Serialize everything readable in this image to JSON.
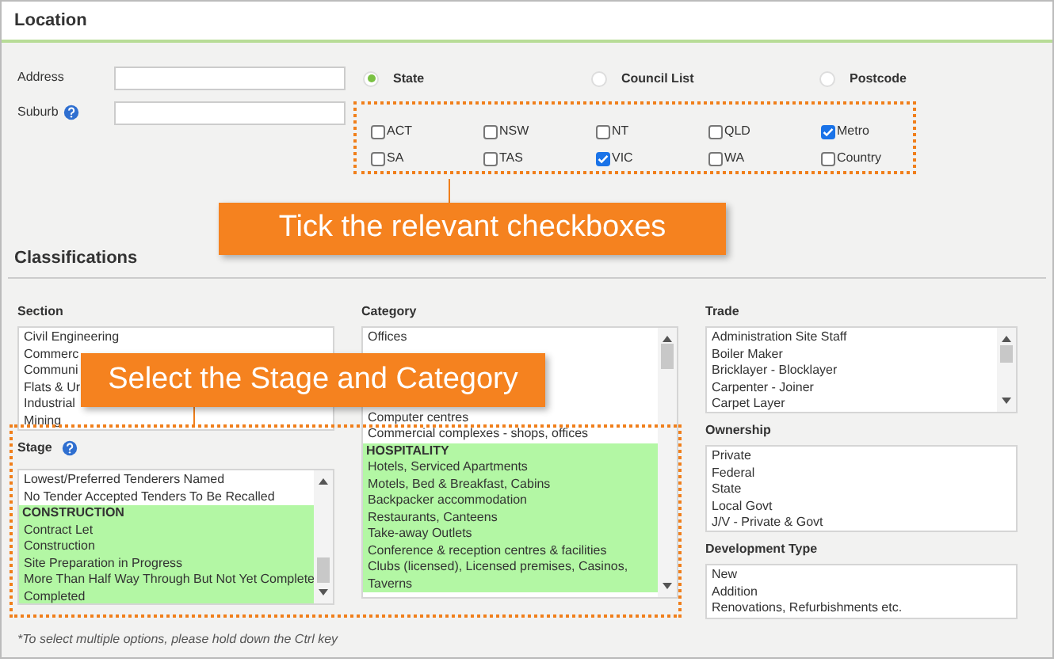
{
  "location": {
    "title": "Location",
    "address": {
      "label": "Address"
    },
    "suburb": {
      "label": "Suburb"
    },
    "modes": [
      {
        "label": "State",
        "selected": true
      },
      {
        "label": "Council List",
        "selected": false
      },
      {
        "label": "Postcode",
        "selected": false
      }
    ],
    "states": [
      {
        "label": "ACT",
        "checked": false
      },
      {
        "label": "NSW",
        "checked": false
      },
      {
        "label": "NT",
        "checked": false
      },
      {
        "label": "QLD",
        "checked": false
      },
      {
        "label": "Metro",
        "checked": true
      },
      {
        "label": "SA",
        "checked": false
      },
      {
        "label": "TAS",
        "checked": false
      },
      {
        "label": "VIC",
        "checked": true
      },
      {
        "label": "WA",
        "checked": false
      },
      {
        "label": "Country",
        "checked": false
      }
    ]
  },
  "classifications": {
    "title": "Classifications",
    "section": {
      "label": "Section",
      "items": [
        "Civil Engineering",
        "Commerc",
        "Communi",
        "Flats & Ur",
        "Industrial",
        "Mining"
      ]
    },
    "stage": {
      "label": "Stage",
      "items": [
        {
          "text": "Lowest/Preferred Tenderers Named",
          "kind": "option",
          "selected": false
        },
        {
          "text": "No Tender Accepted Tenders To Be Recalled",
          "kind": "option",
          "selected": false
        },
        {
          "text": "CONSTRUCTION",
          "kind": "group",
          "selected": true
        },
        {
          "text": "Contract Let",
          "kind": "option",
          "selected": true
        },
        {
          "text": "Construction",
          "kind": "option",
          "selected": true
        },
        {
          "text": "Site Preparation in Progress",
          "kind": "option",
          "selected": true
        },
        {
          "text": "More Than Half Way Through But Not Yet Complete",
          "kind": "option",
          "selected": true
        },
        {
          "text": "Completed",
          "kind": "option",
          "selected": true
        }
      ]
    },
    "category": {
      "label": "Category",
      "items_top": [
        "Offices"
      ],
      "items": [
        {
          "text": "Computer centres",
          "kind": "option",
          "selected": false
        },
        {
          "text": "Commercial complexes - shops, offices",
          "kind": "option",
          "selected": false
        },
        {
          "text": "HOSPITALITY",
          "kind": "group",
          "selected": true
        },
        {
          "text": "Hotels, Serviced Apartments",
          "kind": "option",
          "selected": true
        },
        {
          "text": "Motels, Bed & Breakfast, Cabins",
          "kind": "option",
          "selected": true
        },
        {
          "text": "Backpacker accommodation",
          "kind": "option",
          "selected": true
        },
        {
          "text": "Restaurants, Canteens",
          "kind": "option",
          "selected": true
        },
        {
          "text": "Take-away Outlets",
          "kind": "option",
          "selected": true
        },
        {
          "text": "Conference & reception centres & facilities",
          "kind": "option",
          "selected": true
        },
        {
          "text": "Clubs (licensed), Licensed premises, Casinos, Taverns",
          "kind": "option",
          "selected": true
        }
      ]
    },
    "trade": {
      "label": "Trade",
      "items": [
        "Administration Site Staff",
        "Boiler Maker",
        "Bricklayer - Blocklayer",
        "Carpenter - Joiner",
        "Carpet Layer"
      ]
    },
    "ownership": {
      "label": "Ownership",
      "items": [
        "Private",
        "Federal",
        "State",
        "Local Govt",
        "J/V - Private & Govt"
      ]
    },
    "development_type": {
      "label": "Development Type",
      "items": [
        "New",
        "Addition",
        "Renovations, Refurbishments etc."
      ]
    },
    "note": "*To select multiple options, please hold down the Ctrl key"
  },
  "annotations": [
    {
      "text": "Tick the relevant checkboxes"
    },
    {
      "text": "Select the Stage and Category"
    }
  ]
}
